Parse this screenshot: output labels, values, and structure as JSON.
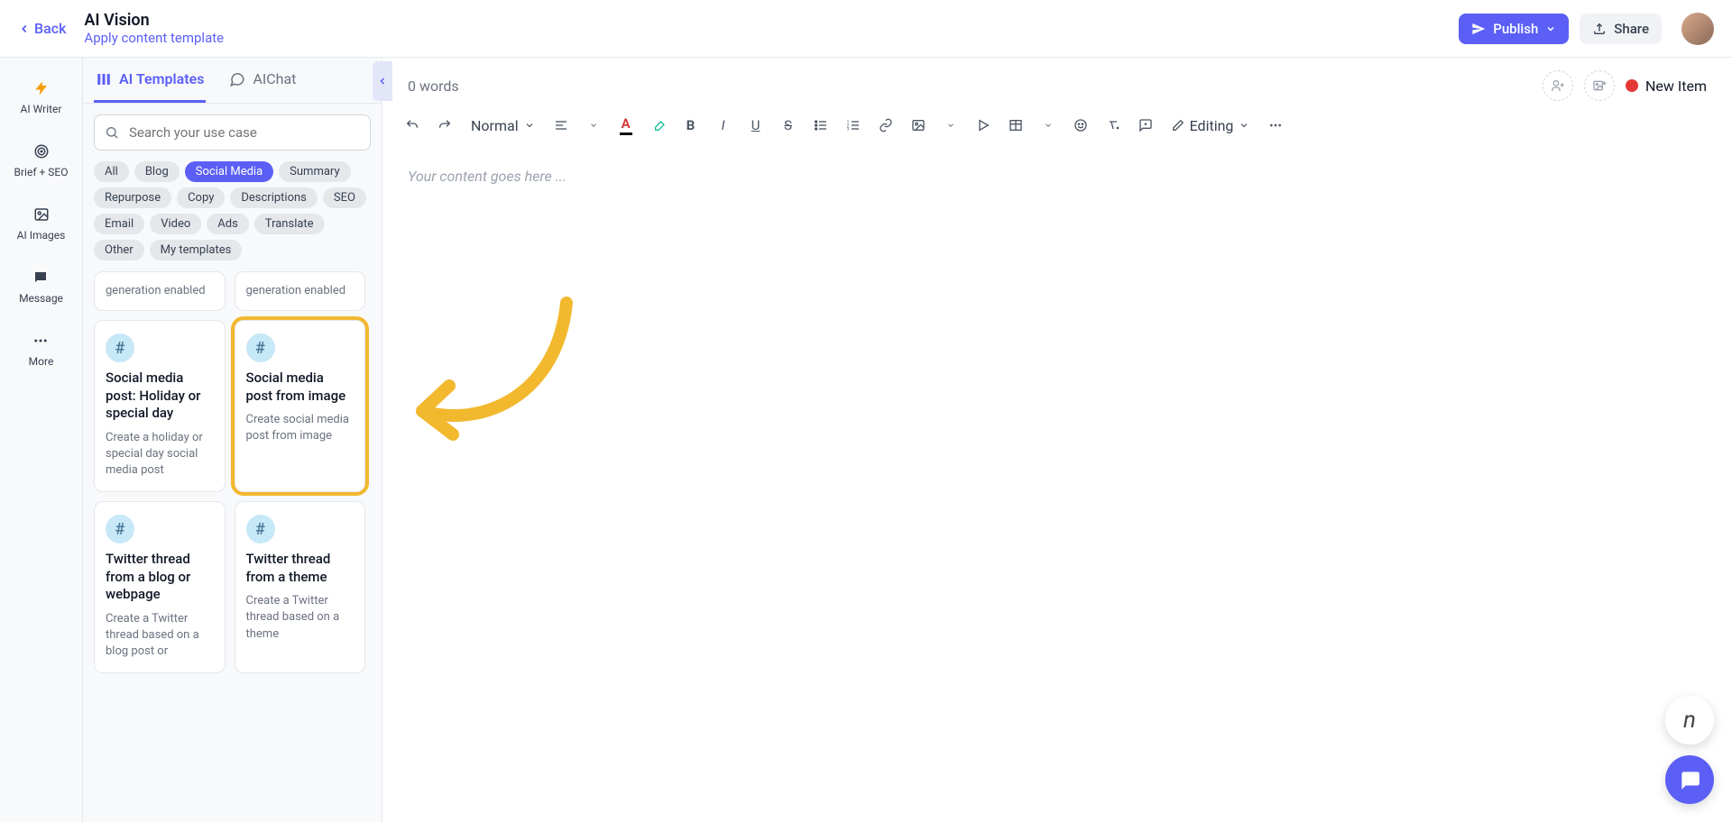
{
  "topbar": {
    "back": "Back",
    "title": "AI Vision",
    "subtitle": "Apply content template",
    "publish": "Publish",
    "share": "Share"
  },
  "rail": {
    "items": [
      {
        "label": "AI Writer",
        "icon": "bolt"
      },
      {
        "label": "Brief + SEO",
        "icon": "target"
      },
      {
        "label": "AI Images",
        "icon": "image"
      },
      {
        "label": "Message",
        "icon": "chat"
      },
      {
        "label": "More",
        "icon": "dots"
      }
    ]
  },
  "sidebar": {
    "tabs": [
      {
        "label": "AI Templates",
        "active": true
      },
      {
        "label": "AIChat",
        "active": false
      }
    ],
    "search_placeholder": "Search your use case",
    "chips": [
      "All",
      "Blog",
      "Social Media",
      "Summary",
      "Repurpose",
      "Copy",
      "Descriptions",
      "SEO",
      "Email",
      "Video",
      "Ads",
      "Translate",
      "Other",
      "My templates"
    ],
    "active_chip": "Social Media",
    "stub_cards": [
      {
        "desc": "generation enabled"
      },
      {
        "desc": "generation enabled"
      }
    ],
    "cards": [
      {
        "title": "Social media post: Holiday or special day",
        "desc": "Create a holiday or special day social media post",
        "highlight": false
      },
      {
        "title": "Social media post from image",
        "desc": "Create social media post from image",
        "highlight": true
      },
      {
        "title": "Twitter thread from a blog or webpage",
        "desc": "Create a Twitter thread based on a blog post or",
        "highlight": false
      },
      {
        "title": "Twitter thread from a theme",
        "desc": "Create a Twitter thread based on a theme",
        "highlight": false
      }
    ]
  },
  "editor": {
    "word_count": "0 words",
    "new_item": "New Item",
    "style_select": "Normal",
    "mode_select": "Editing",
    "placeholder": "Your content goes here ..."
  }
}
